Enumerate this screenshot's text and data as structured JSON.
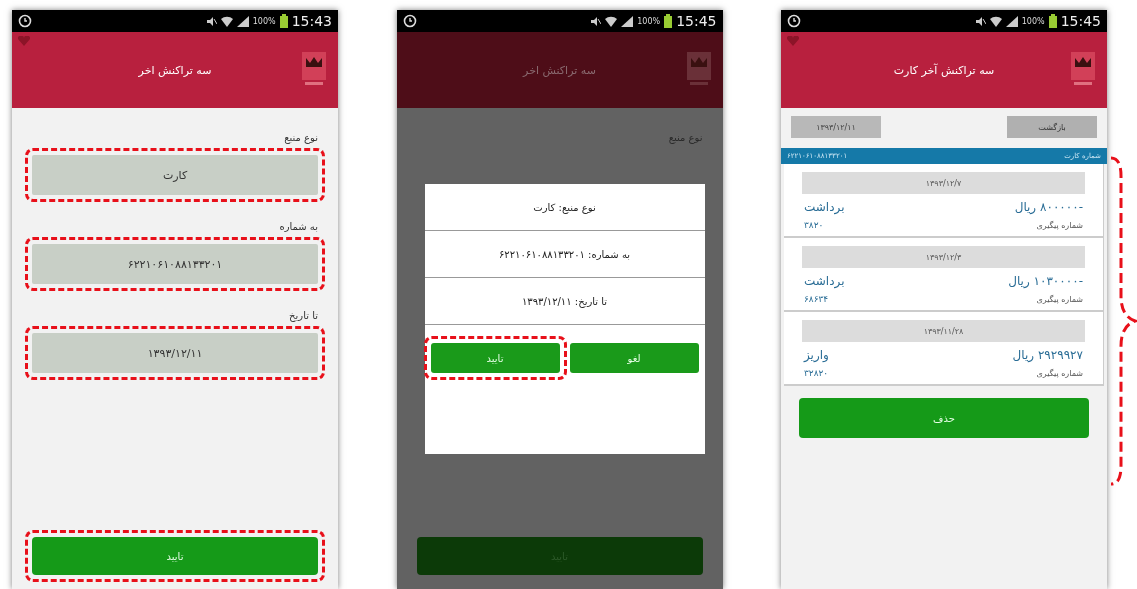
{
  "screens": [
    {
      "kind": "list",
      "time": "15:45",
      "battery": "100%",
      "title": "سه تراکنش آخر کارت",
      "date": "۱۳۹۳/۱۲/۱۱",
      "back": "بازگشت",
      "card_label": "شماره کارت",
      "card_number": "۶۲۲۱۰۶۱۰۸۸۱۳۳۲۰۱",
      "transactions": [
        {
          "date": "۱۳۹۳/۱۲/۷",
          "amount": "-۸۰۰۰۰۰ ریال",
          "type": "برداشت",
          "ref_label": "شماره پیگیری",
          "ref": "۳۸۲۰"
        },
        {
          "date": "۱۳۹۳/۱۲/۳",
          "amount": "-۱۰۳۰۰۰۰ ریال",
          "type": "برداشت",
          "ref_label": "شماره پیگیری",
          "ref": "۶۸۶۳۴"
        },
        {
          "date": "۱۳۹۳/۱۱/۲۸",
          "amount": "۲۹۲۹۹۲۷ ریال",
          "type": "واریز",
          "ref_label": "شماره پیگیری",
          "ref": "۳۲۸۲۰"
        }
      ],
      "delete": "حذف"
    },
    {
      "kind": "dialog",
      "time": "15:45",
      "battery": "100%",
      "title": "سه تراکنش اخر",
      "background_label": "نوع منبع",
      "dialog": {
        "lines": [
          "نوع منبع: کارت",
          "به شماره: ۶۲۲۱۰۶۱۰۸۸۱۳۳۲۰۱",
          "تا تاریخ: ۱۳۹۳/۱۲/۱۱"
        ],
        "buttons": [
          {
            "label": "لغو",
            "highlighted": false
          },
          {
            "label": "تایید",
            "highlighted": true
          }
        ]
      },
      "submit": {
        "label": "تایید",
        "highlighted": false
      }
    },
    {
      "kind": "form",
      "time": "15:43",
      "battery": "100%",
      "title": "سه تراکنش اخر",
      "fields": [
        {
          "label": "نوع منبع",
          "value": "کارت",
          "highlighted": true
        },
        {
          "label": "به شماره",
          "value": "۶۲۲۱۰۶۱۰۸۸۱۳۳۲۰۱",
          "highlighted": true
        },
        {
          "label": "تا تاریخ",
          "value": "۱۳۹۳/۱۲/۱۱",
          "highlighted": true
        }
      ],
      "submit": {
        "label": "تایید",
        "highlighted": true
      }
    }
  ]
}
